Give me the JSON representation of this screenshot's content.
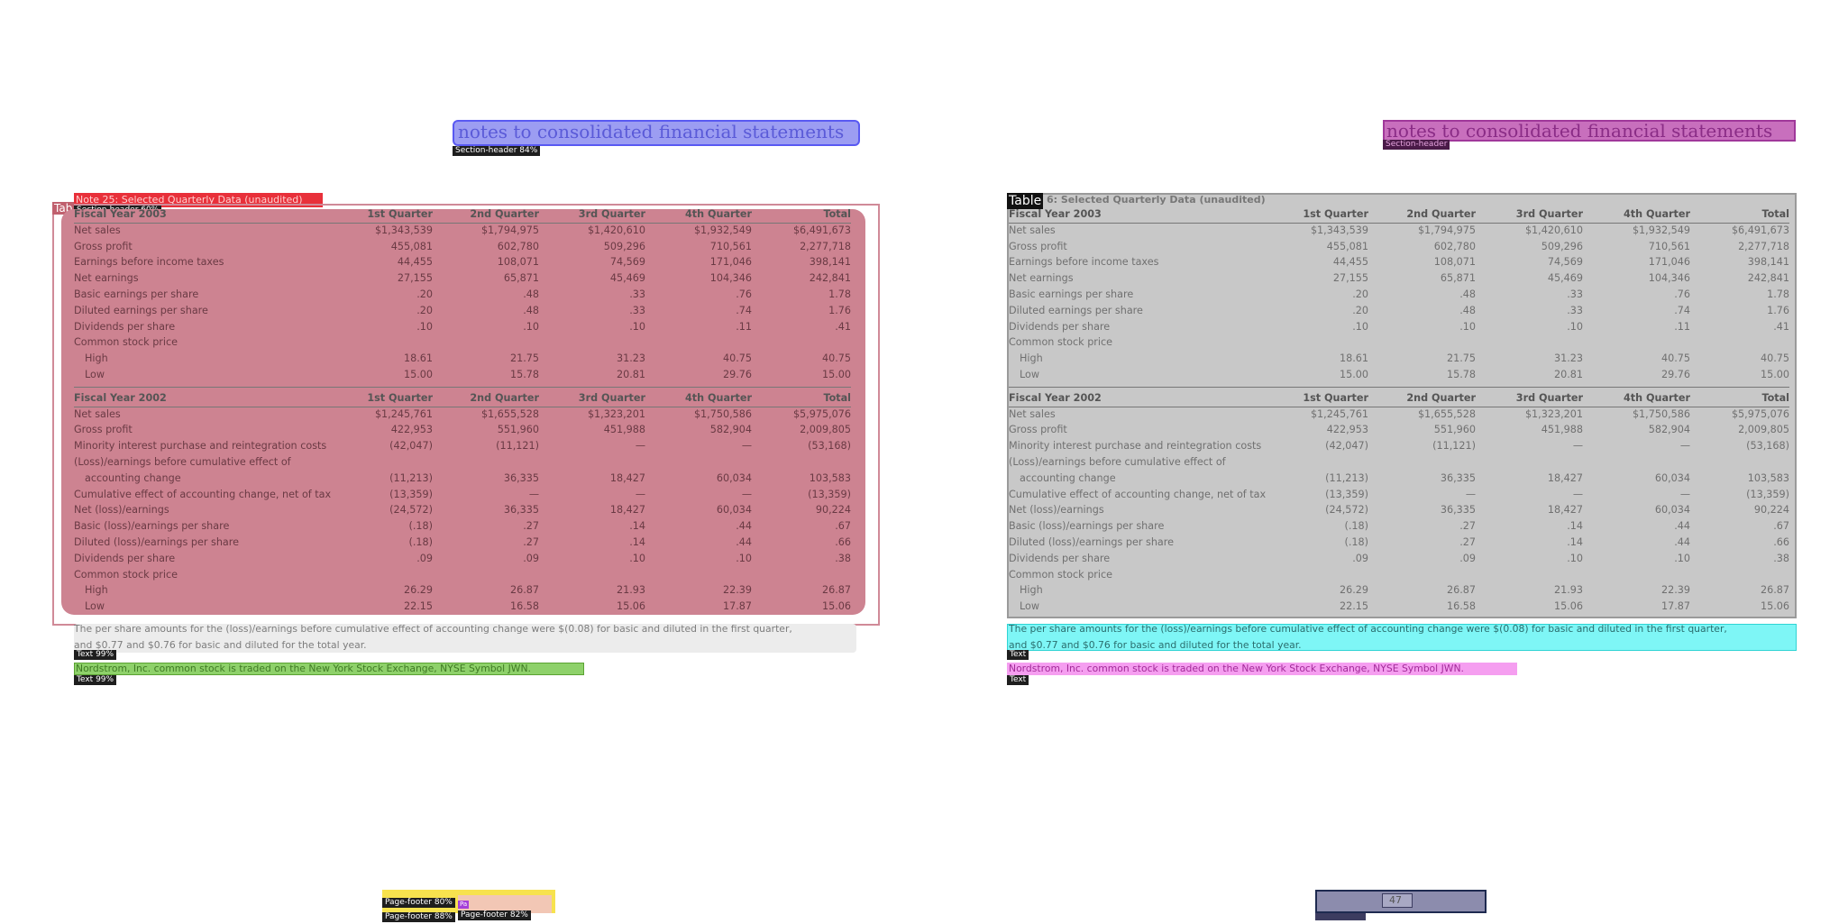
{
  "left": {
    "section_header": "notes to consolidated financial statements",
    "section_header_tag": "Section-header 84%",
    "note_heading": "Note 25: Selected Quarterly Data (unaudited)",
    "note_heading_tag": "Section-header 60%",
    "table_tag": "Tab",
    "text1_tag": "Text 99%",
    "text2_tag": "Text 99%",
    "footer_tag1": "Page-footer 80%",
    "footer_tag2": "Page-footer 88%",
    "footer_tag3": "Page-footer 82%",
    "footer_tag_small": "Pa"
  },
  "right": {
    "section_header": "notes to consolidated financial statements",
    "section_header_tag": "Section-header",
    "table_tag": "Table",
    "table_caption": "6: Selected Quarterly Data (unaudited)",
    "text1_tag": "Text",
    "text2_tag": "Text",
    "page_number": "47"
  },
  "table": {
    "headers": [
      "1st Quarter",
      "2nd Quarter",
      "3rd Quarter",
      "4th Quarter",
      "Total"
    ],
    "fy2003_title": "Fiscal Year 2003",
    "fy2003_rows": [
      {
        "label": "Net sales",
        "indent": false,
        "vals": [
          "$1,343,539",
          "$1,794,975",
          "$1,420,610",
          "$1,932,549",
          "$6,491,673"
        ]
      },
      {
        "label": "Gross profit",
        "indent": false,
        "vals": [
          "455,081",
          "602,780",
          "509,296",
          "710,561",
          "2,277,718"
        ]
      },
      {
        "label": "Earnings before income taxes",
        "indent": false,
        "vals": [
          "44,455",
          "108,071",
          "74,569",
          "171,046",
          "398,141"
        ]
      },
      {
        "label": "Net earnings",
        "indent": false,
        "vals": [
          "27,155",
          "65,871",
          "45,469",
          "104,346",
          "242,841"
        ]
      },
      {
        "label": "Basic earnings per share",
        "indent": false,
        "vals": [
          ".20",
          ".48",
          ".33",
          ".76",
          "1.78"
        ]
      },
      {
        "label": "Diluted earnings per share",
        "indent": false,
        "vals": [
          ".20",
          ".48",
          ".33",
          ".74",
          "1.76"
        ]
      },
      {
        "label": "Dividends per share",
        "indent": false,
        "vals": [
          ".10",
          ".10",
          ".10",
          ".11",
          ".41"
        ]
      },
      {
        "label": "Common stock price",
        "indent": false,
        "vals": [
          "",
          "",
          "",
          "",
          ""
        ]
      },
      {
        "label": "High",
        "indent": true,
        "vals": [
          "18.61",
          "21.75",
          "31.23",
          "40.75",
          "40.75"
        ]
      },
      {
        "label": "Low",
        "indent": true,
        "vals": [
          "15.00",
          "15.78",
          "20.81",
          "29.76",
          "15.00"
        ]
      }
    ],
    "fy2002_title": "Fiscal Year 2002",
    "fy2002_rows": [
      {
        "label": "Net sales",
        "indent": false,
        "vals": [
          "$1,245,761",
          "$1,655,528",
          "$1,323,201",
          "$1,750,586",
          "$5,975,076"
        ]
      },
      {
        "label": "Gross profit",
        "indent": false,
        "vals": [
          "422,953",
          "551,960",
          "451,988",
          "582,904",
          "2,009,805"
        ]
      },
      {
        "label": "Minority interest purchase and reintegration costs",
        "indent": false,
        "vals": [
          "(42,047)",
          "(11,121)",
          "—",
          "—",
          "(53,168)"
        ]
      },
      {
        "label": "(Loss)/earnings before cumulative effect of",
        "indent": false,
        "vals": [
          "",
          "",
          "",
          "",
          ""
        ]
      },
      {
        "label": "accounting change",
        "indent": true,
        "vals": [
          "(11,213)",
          "36,335",
          "18,427",
          "60,034",
          "103,583"
        ]
      },
      {
        "label": "Cumulative effect of accounting change, net of tax",
        "indent": false,
        "vals": [
          "(13,359)",
          "—",
          "—",
          "—",
          "(13,359)"
        ]
      },
      {
        "label": "Net (loss)/earnings",
        "indent": false,
        "vals": [
          "(24,572)",
          "36,335",
          "18,427",
          "60,034",
          "90,224"
        ]
      },
      {
        "label": "Basic (loss)/earnings per share",
        "indent": false,
        "vals": [
          "(.18)",
          ".27",
          ".14",
          ".44",
          ".67"
        ]
      },
      {
        "label": "Diluted (loss)/earnings per share",
        "indent": false,
        "vals": [
          "(.18)",
          ".27",
          ".14",
          ".44",
          ".66"
        ]
      },
      {
        "label": "Dividends per share",
        "indent": false,
        "vals": [
          ".09",
          ".09",
          ".10",
          ".10",
          ".38"
        ]
      },
      {
        "label": "Common stock price",
        "indent": false,
        "vals": [
          "",
          "",
          "",
          "",
          ""
        ]
      },
      {
        "label": "High",
        "indent": true,
        "vals": [
          "26.29",
          "26.87",
          "21.93",
          "22.39",
          "26.87"
        ]
      },
      {
        "label": "Low",
        "indent": true,
        "vals": [
          "22.15",
          "16.58",
          "15.06",
          "17.87",
          "15.06"
        ]
      }
    ]
  },
  "notes": {
    "line1": "The per share amounts for the (loss)/earnings before cumulative effect of accounting change were $(0.08) for basic and diluted in the first quarter,",
    "line2": "and $0.77 and $0.76 for basic and diluted for the total year.",
    "nyse": "Nordstrom, Inc. common stock is traded on the New York Stock Exchange, NYSE Symbol JWN."
  },
  "colors": {
    "table_left": "#cd8391",
    "table_right": "#c8c8c8",
    "header_left": "#8b8df0",
    "header_right": "#c86fbd",
    "text_right": "#7ef6f6",
    "nyse_left": "#8ed16a",
    "nyse_right": "#f59ef0",
    "footer_yellow": "#f7e24e",
    "footer_right": "#8c8cad"
  }
}
